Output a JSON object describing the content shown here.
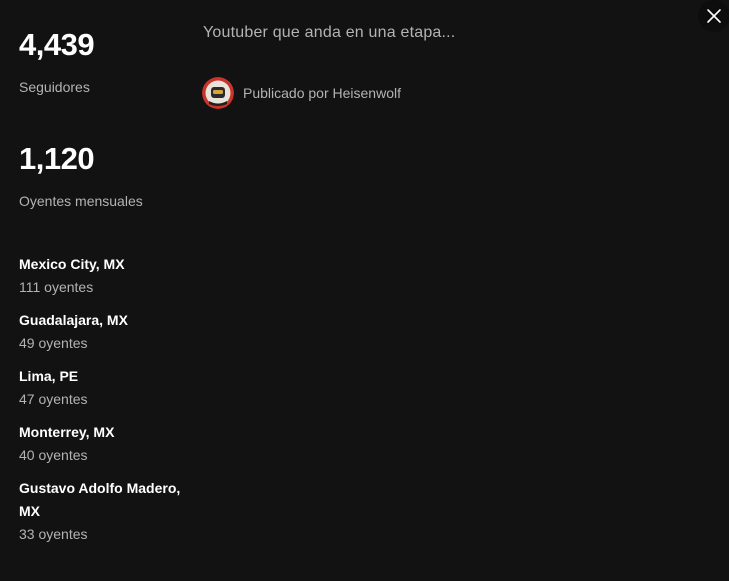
{
  "stats": {
    "followers": {
      "value": "4,439",
      "label": "Seguidores"
    },
    "monthly_listeners": {
      "value": "1,120",
      "label": "Oyentes mensuales"
    }
  },
  "cities": [
    {
      "name": "Mexico City, MX",
      "listeners": "111 oyentes"
    },
    {
      "name": "Guadalajara, MX",
      "listeners": "49 oyentes"
    },
    {
      "name": "Lima, PE",
      "listeners": "47 oyentes"
    },
    {
      "name": "Monterrey, MX",
      "listeners": "40 oyentes"
    },
    {
      "name": "Gustavo Adolfo Madero, MX",
      "listeners": "33 oyentes"
    }
  ],
  "bio": {
    "text": "Youtuber que anda en una etapa...",
    "posted_by": "Publicado por Heisenwolf"
  },
  "icons": {
    "close": "close-icon",
    "avatar": "avatar"
  },
  "colors": {
    "background": "#121212",
    "primary_text": "#ffffff",
    "secondary_text": "#b3b3b3"
  }
}
